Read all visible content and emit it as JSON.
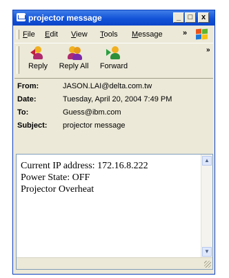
{
  "window": {
    "title": "projector message"
  },
  "titlebar_buttons": {
    "minimize": "_",
    "maximize": "□",
    "close": "x"
  },
  "menubar": {
    "items": [
      {
        "u": "F",
        "rest": "ile"
      },
      {
        "u": "E",
        "rest": "dit"
      },
      {
        "u": "V",
        "rest": "iew"
      },
      {
        "u": "T",
        "rest": "ools"
      },
      {
        "u": "M",
        "rest": "essage"
      }
    ],
    "overflow": "»"
  },
  "toolbar": {
    "buttons": [
      {
        "label": "Reply",
        "icon": "reply-icon"
      },
      {
        "label": "Reply All",
        "icon": "reply-all-icon"
      },
      {
        "label": "Forward",
        "icon": "forward-icon"
      }
    ],
    "overflow": "»"
  },
  "headers": {
    "from_label": "From:",
    "from": "JASON.LAI@delta.com.tw",
    "date_label": "Date:",
    "date": "Tuesday, April 20, 2004 7:49 PM",
    "to_label": "To:",
    "to": "Guess@ibm.com",
    "subject_label": "Subject:",
    "subject": "projector message"
  },
  "message": {
    "line1": "Current IP address: 172.16.8.222",
    "line2": "Power State: OFF",
    "line3": "",
    "line4": "Projector Overheat"
  },
  "colors": {
    "titlebar": "#1253d8",
    "chrome": "#ece9d8"
  }
}
